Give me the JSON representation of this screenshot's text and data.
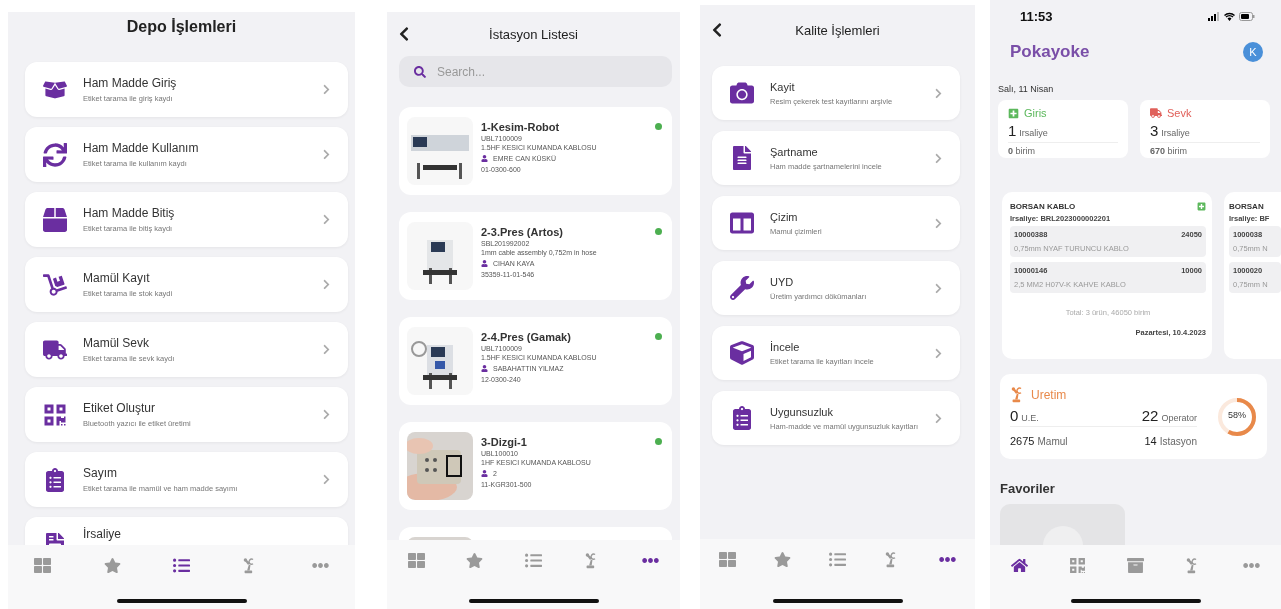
{
  "depo": {
    "title": "Depo İşlemleri",
    "items": [
      {
        "title": "Ham Madde Giriş",
        "subtitle": "Etiket tarama ile giriş kaydı"
      },
      {
        "title": "Ham Madde Kullanım",
        "subtitle": "Etiket tarama ile kullanım kaydı"
      },
      {
        "title": "Ham Madde Bitiş",
        "subtitle": "Etiket tarama ile bitiş kaydı"
      },
      {
        "title": "Mamül Kayıt",
        "subtitle": "Etiket tarama ile stok kaydi"
      },
      {
        "title": "Mamül Sevk",
        "subtitle": "Etiket tarama ile sevk kaydı"
      },
      {
        "title": "Etiket Oluştur",
        "subtitle": "Bluetooth yazıcı ile etiket üretimi"
      },
      {
        "title": "Sayım",
        "subtitle": "Etiket tarama ile mamül ve ham madde sayımı"
      },
      {
        "title": "İrsaliye"
      }
    ],
    "tabs": [
      {
        "selected": false
      },
      {
        "selected": false
      },
      {
        "selected": true
      },
      {
        "selected": false
      },
      {
        "selected": false
      }
    ]
  },
  "istasyon": {
    "title": "İstasyon Listesi",
    "search": {
      "placeholder": "Search..."
    },
    "stations": [
      {
        "kind": "station",
        "name": "1-Kesim-Robot",
        "code": "UBL7100009",
        "product": "1.5HF KESICI KUMANDA KABLOSU",
        "operator": "EMRE CAN KÜSKÜ",
        "number": "01-0300-600",
        "active": true
      },
      {
        "kind": "station",
        "name": "2-3.Pres (Artos)",
        "code": "SBL201992002",
        "product": "1mm cable assembly 0,752m in hose",
        "operator": "CIHAN KAYA",
        "number": "35359-11-01-546",
        "active": true
      },
      {
        "kind": "station",
        "name": "2-4.Pres (Gamak)",
        "code": "UBL7100009",
        "product": "1.5HF KESICI KUMANDA KABLOSU",
        "operator": "SABAHATTIN YILMAZ",
        "number": "12-0300-240",
        "active": true
      },
      {
        "kind": "station",
        "name": "3-Dizgi-1",
        "code": "UBL100010",
        "product": "1HF KESICI KUMANDA KABLOSU",
        "operator": "2",
        "number": "11-KGR301-500",
        "active": true
      },
      {
        "kind": "partial"
      }
    ],
    "tabs": [
      {
        "selected": false
      },
      {
        "selected": false
      },
      {
        "selected": false
      },
      {
        "selected": false
      },
      {
        "selected": true
      }
    ]
  },
  "kalite": {
    "title": "Kalite İşlemleri",
    "items": [
      {
        "title": "Kayit",
        "subtitle": "Resim çekerek test kayıtlarını arşivle"
      },
      {
        "title": "Şartname",
        "subtitle": "Ham madde şartnamelerini incele"
      },
      {
        "title": "Çizim",
        "subtitle": "Mamul çizimleri"
      },
      {
        "title": "UYD",
        "subtitle": "Üretim yardımcı dökümanları"
      },
      {
        "title": "İncele",
        "subtitle": "Etiket tarama ile kayıtları incele"
      },
      {
        "title": "Uygunsuzluk",
        "subtitle": "Ham-madde ve mamül uygunsuzluk kayıtları"
      }
    ],
    "tabs": [
      {
        "selected": false
      },
      {
        "selected": false
      },
      {
        "selected": false
      },
      {
        "selected": false
      },
      {
        "selected": true
      }
    ]
  },
  "home": {
    "time": "11:53",
    "logo": "Pokayoke",
    "avatar": "K",
    "date": "Salı, 11 Nisan",
    "summary": [
      {
        "label": "Giris",
        "color": "#5cb85c",
        "count": "1",
        "unit": "Irsaliye",
        "total": "**0** birim"
      },
      {
        "label": "Sevk",
        "color": "#e0605a",
        "count": "3",
        "unit": "Irsaliye",
        "total": "**670** birim"
      }
    ],
    "shipments": [
      {
        "company": "BORSAN KABLO",
        "waybill": "Irsaliye: BRL2023000002201",
        "lines": [
          {
            "code": "10000388",
            "qty": "24050",
            "desc": "0,75mm NYAF TURUNCU KABLO"
          },
          {
            "code": "10000146",
            "qty": "10000",
            "desc": "2,5 MM2 H07V-K KAHVE KABLO"
          }
        ],
        "total": "Total: 3 ürün, 46050 birim",
        "date": "Pazartesi, 10.4.2023"
      },
      {
        "company": "BORSAN",
        "waybill": "Irsaliye: BF",
        "lines": [
          {
            "code": "1000038",
            "desc": "0,75mm N"
          },
          {
            "code": "1000020",
            "desc": "0,75mm N"
          }
        ]
      }
    ],
    "production": {
      "title": "Uretim",
      "stats": [
        {
          "value": "0",
          "label": "U.E."
        },
        {
          "value": "22",
          "label": "Operator"
        },
        {
          "value": "2675",
          "label": "Mamul"
        },
        {
          "value": "14",
          "label": "Istasyon"
        }
      ],
      "level": 0.58,
      "percent": "58%"
    },
    "favorites_title": "Favoriler",
    "tabs": [
      {
        "selected": true
      },
      {
        "selected": false
      },
      {
        "selected": false
      },
      {
        "selected": false
      },
      {
        "selected": false
      }
    ]
  }
}
